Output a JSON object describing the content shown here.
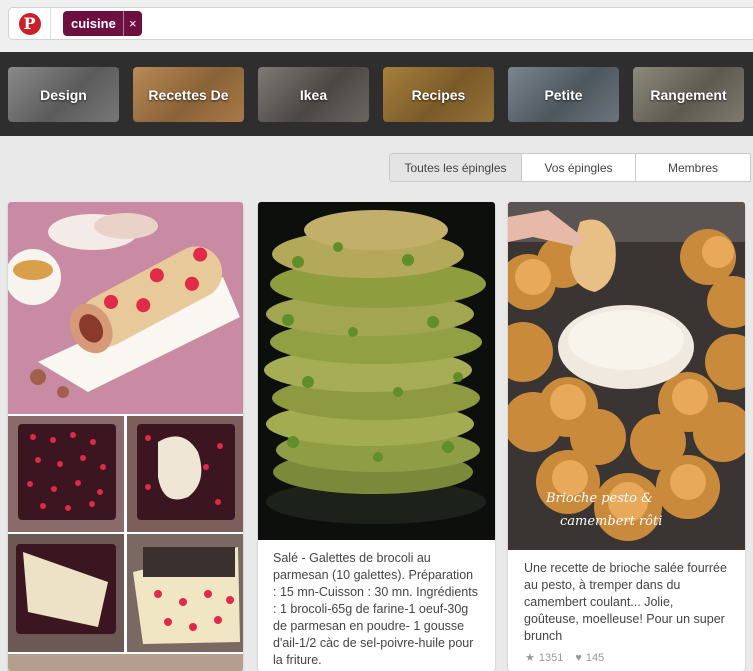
{
  "search": {
    "logo_icon": "pinterest-logo-icon",
    "tag_label": "cuisine",
    "tag_remove": "×"
  },
  "categories": [
    {
      "label": "Design"
    },
    {
      "label": "Recettes De"
    },
    {
      "label": "Ikea"
    },
    {
      "label": "Recipes"
    },
    {
      "label": "Petite"
    },
    {
      "label": "Rangement"
    }
  ],
  "tabs": [
    {
      "label": "Toutes les épingles",
      "active": true
    },
    {
      "label": "Vos épingles",
      "active": false
    },
    {
      "label": "Membres",
      "active": false
    }
  ],
  "pins": [
    {
      "image": "polka-dot-roll-cake-photo-collage",
      "description": ""
    },
    {
      "image": "broccoli-fritters-stack-photo",
      "description": "Salé - Galettes de brocoli au parmesan (10 galettes). Préparation : 15 mn-Cuisson : 30 mn. Ingrédients : 1 brocoli-65g de farine-1 oeuf-30g de parmesan en poudre- 1 gousse d'ail-1/2 càc de sel-poivre-huile pour la friture."
    },
    {
      "image": "brioche-camembert-photo",
      "image_caption": "Brioche pesto & camembert rôti",
      "description": "Une recette de brioche salée fourrée au pesto, à tremper dans du camembert coulant... Jolie, goûteuse, moelleuse! Pour un super brunch",
      "repins": "1351",
      "likes": "145"
    }
  ]
}
